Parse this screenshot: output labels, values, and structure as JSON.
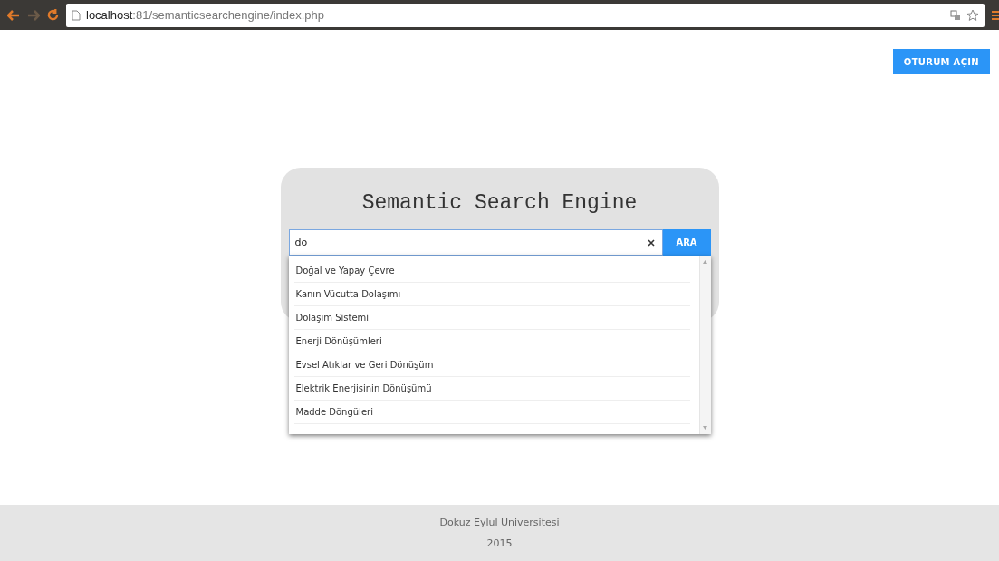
{
  "browser": {
    "url": "**localhost**:81/semanticsearchengine/index.php"
  },
  "login_button": "OTURUM AÇIN",
  "title": "Semantic Search Engine",
  "search": {
    "value": "do",
    "button": "ARA"
  },
  "suggestions": [
    {
      "label": "Doğal ve Yapay Çevre"
    },
    {
      "label": "Kanın Vücutta Dolaşımı"
    },
    {
      "label": "Dolaşım Sistemi"
    },
    {
      "label": "Enerji Dönüşümleri"
    },
    {
      "label": "Evsel Atıklar ve Geri Dönüşüm"
    },
    {
      "label": "Elektrik Enerjisinin Dönüşümü"
    },
    {
      "label": "Madde Döngüleri"
    }
  ],
  "footer": [
    "Dokuz Eylul Universitesi",
    "2015"
  ]
}
